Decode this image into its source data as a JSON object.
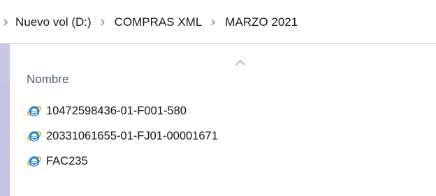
{
  "breadcrumb": {
    "items": [
      {
        "label": "Nuevo vol (D:)"
      },
      {
        "label": "COMPRAS XML"
      },
      {
        "label": "MARZO 2021"
      }
    ]
  },
  "columns": {
    "name_header": "Nombre",
    "sort_indicator_icon": "caret-up-icon"
  },
  "files": [
    {
      "name": "10472598436-01-F001-580",
      "icon": "internet-explorer-icon"
    },
    {
      "name": "20331061655-01-FJ01-00001671",
      "icon": "internet-explorer-icon"
    },
    {
      "name": "FAC235",
      "icon": "internet-explorer-icon"
    }
  ],
  "colors": {
    "background_accent": "#c9c9e6",
    "header_text": "#4c607a",
    "ie_blue": "#1e88e5",
    "ie_ring": "#f4b400"
  }
}
